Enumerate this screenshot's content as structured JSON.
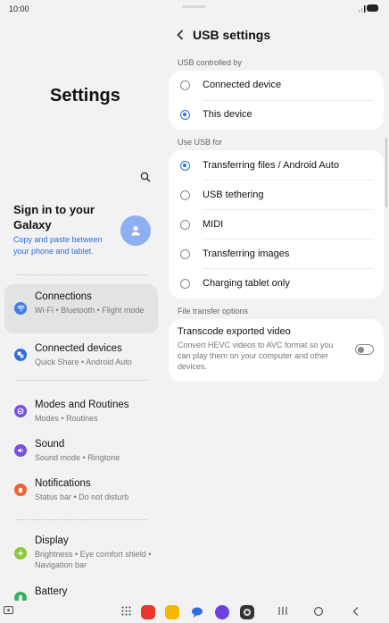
{
  "status": {
    "time": "10:00"
  },
  "sidebar": {
    "title": "Settings",
    "signin_title": "Sign in to your Galaxy",
    "signin_sub": "Copy and paste between your phone and tablet.",
    "items": [
      {
        "label": "Connections",
        "sub": "Wi-Fi  •  Bluetooth  •  Flight mode",
        "icon": "wifi-icon",
        "color": "#3e7cf0"
      },
      {
        "label": "Connected devices",
        "sub": "Quick Share  •  Android Auto",
        "icon": "connected-devices-icon",
        "color": "#2f6de0"
      },
      {
        "label": "Modes and Routines",
        "sub": "Modes  •  Routines",
        "icon": "modes-icon",
        "color": "#7a4fe0"
      },
      {
        "label": "Sound",
        "sub": "Sound mode  •  Ringtone",
        "icon": "sound-icon",
        "color": "#7a4fe0"
      },
      {
        "label": "Notifications",
        "sub": "Status bar  •  Do not disturb",
        "icon": "notifications-icon",
        "color": "#f0612c"
      },
      {
        "label": "Display",
        "sub": "Brightness  •  Eye comfort shield  •  Navigation bar",
        "icon": "display-icon",
        "color": "#8bc83a"
      },
      {
        "label": "Battery",
        "sub": "",
        "icon": "battery-icon",
        "color": "#35b260"
      }
    ]
  },
  "main": {
    "title": "USB settings",
    "controlled_label": "USB controlled by",
    "controlled_options": [
      {
        "label": "Connected device",
        "selected": false
      },
      {
        "label": "This device",
        "selected": true
      }
    ],
    "use_label": "Use USB for",
    "use_options": [
      {
        "label": "Transferring files / Android Auto",
        "selected": true
      },
      {
        "label": "USB tethering",
        "selected": false
      },
      {
        "label": "MIDI",
        "selected": false
      },
      {
        "label": "Transferring images",
        "selected": false
      },
      {
        "label": "Charging tablet only",
        "selected": false
      }
    ],
    "file_transfer_label": "File transfer options",
    "transcode_title": "Transcode exported video",
    "transcode_sub": "Convert HEVC videos to AVC format so you can play them on your computer and other devices.",
    "transcode_on": false
  },
  "colors": {
    "accent": "#2f6de0",
    "background": "#f2f2f4",
    "card": "#ffffff"
  }
}
